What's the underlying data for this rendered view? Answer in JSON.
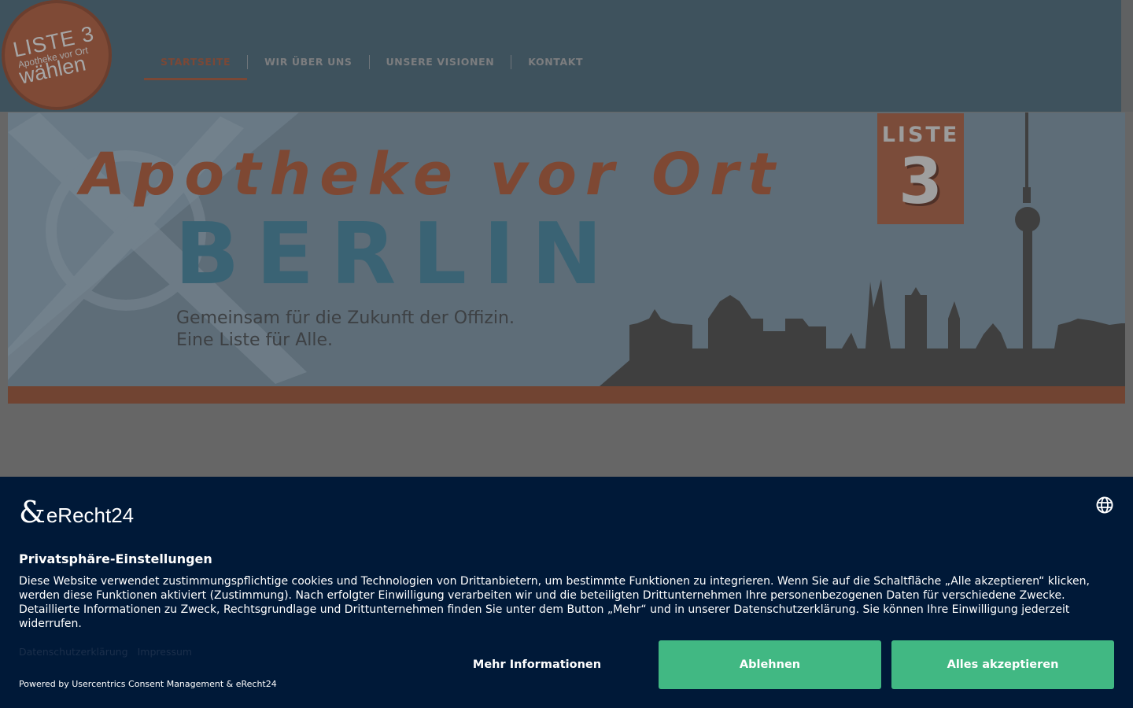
{
  "header": {
    "logo": {
      "line1": "LISTE 3",
      "line2": "Apotheke vor Ort",
      "line3": "wählen"
    },
    "nav": [
      {
        "label": "STARTSEITE",
        "active": true
      },
      {
        "label": "WIR ÜBER UNS",
        "active": false
      },
      {
        "label": "UNSERE VISIONEN",
        "active": false
      },
      {
        "label": "KONTAKT",
        "active": false
      }
    ]
  },
  "banner": {
    "title": "Apotheke vor Ort",
    "city": "BERLIN",
    "subtitle_line1": "Gemeinsam für die Zukunft der Offizin.",
    "subtitle_line2": "Eine Liste für Alle.",
    "list_label": "LISTE",
    "list_number": "3"
  },
  "consent": {
    "brand_name": "eRecht24",
    "title": "Privatsphäre-Einstellungen",
    "text": "Diese Website verwendet zustimmungspflichtige cookies und Technologien von Drittanbietern, um bestimmte Funktionen zu integrieren. Wenn Sie auf die Schaltfläche „Alle akzeptieren“ klicken, werden diese Funktionen aktiviert (Zustimmung). Nach erfolgter Einwilligung verarbeiten wir und die beteiligten Drittunternehmen Ihre personenbezogenen Daten für verschiedene Zwecke. Detaillierte Informationen zu Zweck, Rechtsgrundlage und Drittunternehmen finden Sie unter dem Button „Mehr“ und in unserer Datenschutzerklärung. Sie können Ihre Einwilligung jederzeit widerrufen.",
    "links": {
      "privacy": "Datenschutzerklärung",
      "imprint": "Impressum"
    },
    "powered_by": "Powered by Usercentrics Consent Management & eRecht24",
    "buttons": {
      "more": "Mehr Informationen",
      "deny": "Ablehnen",
      "accept": "Alles akzeptieren"
    },
    "icons": {
      "language": "globe-icon",
      "brand": "ampersand-logo-icon"
    }
  },
  "colors": {
    "header_bg": "#3e525d",
    "accent": "#7b4836",
    "consent_bg": "#001938",
    "button_green": "#41b883"
  }
}
